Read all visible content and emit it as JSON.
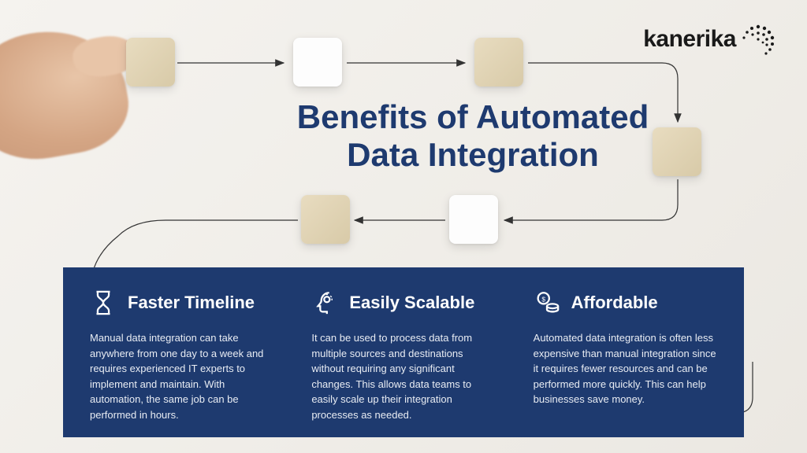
{
  "logo": {
    "text": "kanerika"
  },
  "title": "Benefits of Automated\nData Integration",
  "columns": [
    {
      "title": "Faster Timeline",
      "body": "Manual data integration can take anywhere from one day to a week and requires experienced IT experts to implement and maintain. With automation, the same job can be performed in hours."
    },
    {
      "title": "Easily Scalable",
      "body": "It can be used to process data from multiple sources and destinations without requiring any significant changes. This allows data teams to easily scale up their integration processes as needed."
    },
    {
      "title": "Affordable",
      "body": "Automated data integration is often less expensive than manual integration since it requires fewer resources and can be performed more quickly. This can help businesses save money."
    }
  ]
}
